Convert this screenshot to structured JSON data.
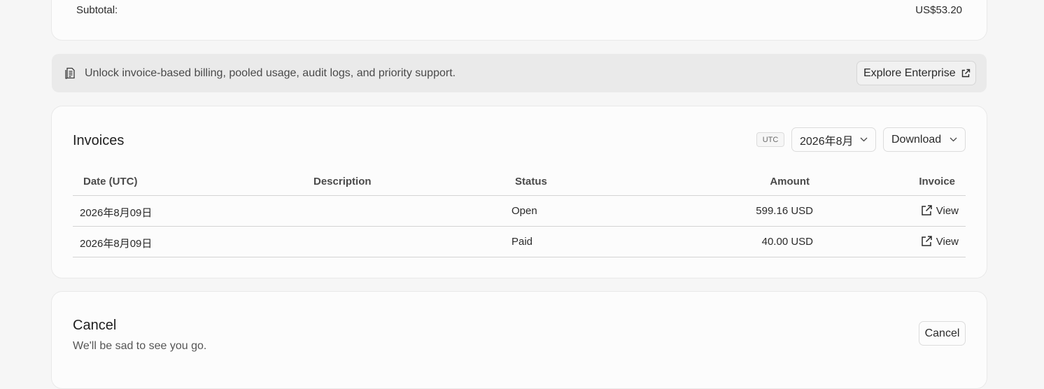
{
  "subtotal": {
    "label": "Subtotal:",
    "value": "US$53.20"
  },
  "banner": {
    "icon": "receipt-icon",
    "text": "Unlock invoice-based billing, pooled usage, audit logs, and priority support.",
    "button_label": "Explore Enterprise",
    "button_icon": "external-link-icon"
  },
  "invoices": {
    "title": "Invoices",
    "timezone_badge": "UTC",
    "month_select": "2026年8月",
    "download_label": "Download",
    "columns": {
      "date": "Date (UTC)",
      "description": "Description",
      "status": "Status",
      "amount": "Amount",
      "invoice": "Invoice"
    },
    "rows": [
      {
        "date": "2026年8月09日",
        "description": "",
        "status": "Open",
        "amount": "599.16 USD",
        "invoice": "View"
      },
      {
        "date": "2026年8月09日",
        "description": "",
        "status": "Paid",
        "amount": "40.00 USD",
        "invoice": "View"
      }
    ]
  },
  "cancel": {
    "title": "Cancel",
    "subtitle": "We'll be sad to see you go.",
    "button_label": "Cancel"
  }
}
